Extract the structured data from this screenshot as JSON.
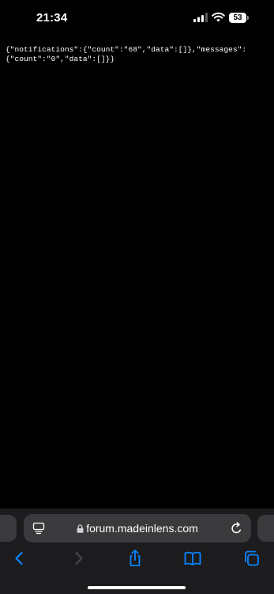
{
  "status_bar": {
    "time": "21:34",
    "battery_level": "53",
    "icons": [
      "signal-icon",
      "wifi-icon",
      "battery-icon"
    ]
  },
  "page": {
    "json_text": "{\"notifications\":{\"count\":\"68\",\"data\":[]},\"messages\":\n{\"count\":\"0\",\"data\":[]}}"
  },
  "browser": {
    "url": "forum.madeinlens.com",
    "accent_color": "#0a84ff",
    "toolbar_buttons": [
      "back",
      "forward",
      "share",
      "bookmarks",
      "tabs"
    ]
  }
}
